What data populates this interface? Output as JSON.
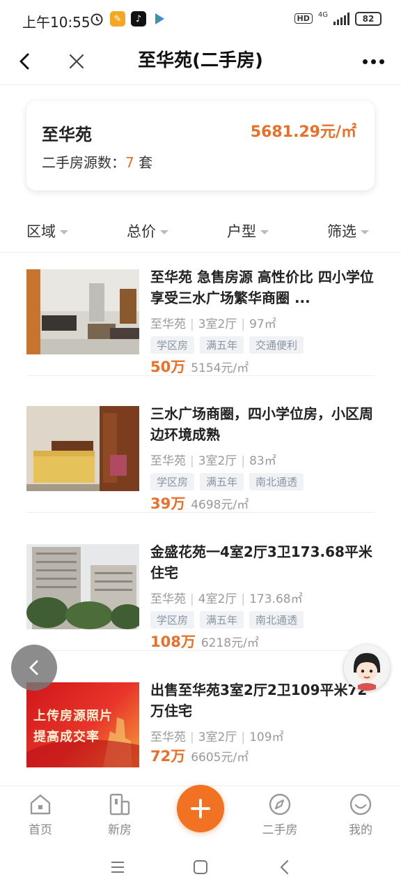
{
  "status_bar": {
    "time": "上午10:55",
    "network": "4G",
    "hd": "HD",
    "battery": "82"
  },
  "navbar": {
    "title": "至华苑(二手房)"
  },
  "summary": {
    "name": "至华苑",
    "price": "5681.29元/㎡",
    "count_label": "二手房源数：",
    "count_value": "7",
    "count_unit": "套"
  },
  "filters": [
    "区域",
    "总价",
    "户型",
    "筛选"
  ],
  "listings": [
    {
      "title": "至华苑 急售房源 高性价比 四小学位 享受三水广场繁华商圈 ...",
      "community": "至华苑",
      "layout": "3室2厅",
      "area": "97㎡",
      "tags": [
        "学区房",
        "满五年",
        "交通便利"
      ],
      "total": "50万",
      "unit_price": "5154元/㎡"
    },
    {
      "title": "三水广场商圈，四小学位房，小区周边环境成熟",
      "community": "至华苑",
      "layout": "3室2厅",
      "area": "83㎡",
      "tags": [
        "学区房",
        "满五年",
        "南北通透"
      ],
      "total": "39万",
      "unit_price": "4698元/㎡"
    },
    {
      "title": "金盛花苑一4室2厅3卫173.68平米住宅",
      "community": "至华苑",
      "layout": "4室2厅",
      "area": "173.68㎡",
      "tags": [
        "学区房",
        "满五年",
        "南北通透"
      ],
      "total": "108万",
      "unit_price": "6218元/㎡"
    },
    {
      "title": "出售至华苑3室2厅2卫109平米72万住宅",
      "community": "至华苑",
      "layout": "3室2厅",
      "area": "109㎡",
      "tags": [],
      "total": "72万",
      "unit_price": "6605元/㎡",
      "image_caption_line1": "上传房源照片",
      "image_caption_line2": "提高成交率"
    }
  ],
  "tabbar": {
    "home": "首页",
    "new_house": "新房",
    "second_hand": "二手房",
    "mine": "我的"
  },
  "colors": {
    "accent": "#e8702a",
    "tag_bg": "#f0f2f5",
    "tag_text": "#8a95a3"
  }
}
